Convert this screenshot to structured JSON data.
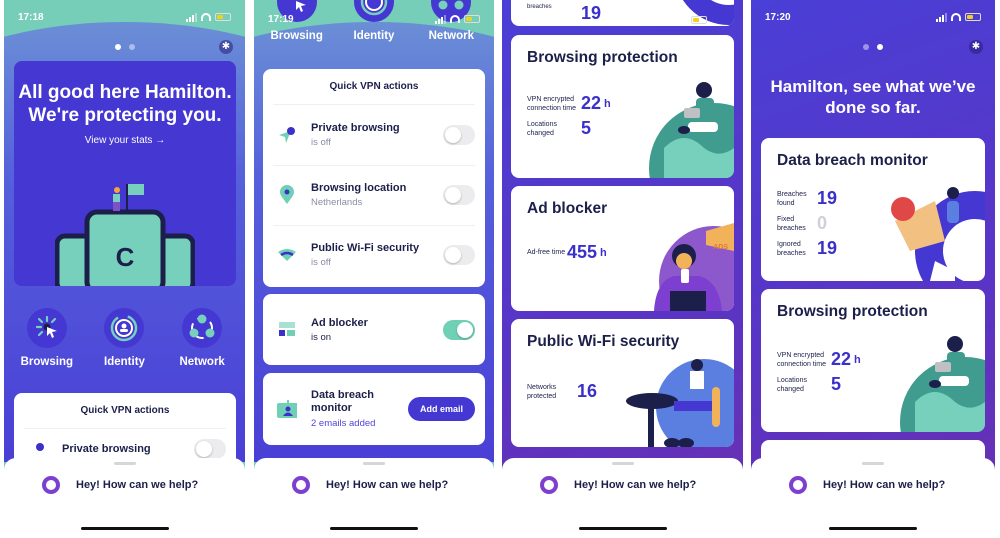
{
  "screens": [
    {
      "status": {
        "time": "17:18"
      },
      "hero": {
        "title": "All good here Hamilton. We're protecting you.",
        "link": "View your stats →"
      },
      "features": [
        {
          "label": "Browsing",
          "icon": "cursor-click-icon"
        },
        {
          "label": "Identity",
          "icon": "identity-shield-icon"
        },
        {
          "label": "Network",
          "icon": "network-icon"
        }
      ],
      "quick_vpn": {
        "title": "Quick VPN actions",
        "first_item": "Private browsing"
      },
      "help": "Hey! How can we help?"
    },
    {
      "status": {
        "time": "17:19"
      },
      "features": [
        {
          "label": "Browsing"
        },
        {
          "label": "Identity"
        },
        {
          "label": "Network"
        }
      ],
      "quick_vpn": {
        "title": "Quick VPN actions",
        "items": [
          {
            "title": "Private browsing",
            "sub": "is off",
            "on": false
          },
          {
            "title": "Browsing location",
            "sub": "Netherlands",
            "on": false
          },
          {
            "title": "Public Wi-Fi security",
            "sub": "is off",
            "on": false
          }
        ]
      },
      "ad_blocker": {
        "title": "Ad blocker",
        "sub": "is on",
        "on": true
      },
      "breach": {
        "title": "Data breach monitor",
        "sub": "2 emails added",
        "button": "Add email"
      },
      "help": "Hey! How can we help?"
    },
    {
      "top_partial": {
        "value": "19",
        "label": "breaches"
      },
      "browsing": {
        "title": "Browsing protection",
        "stats": [
          {
            "label": "VPN encrypted connection time",
            "value": "22",
            "unit": "h"
          },
          {
            "label": "Locations changed",
            "value": "5"
          }
        ]
      },
      "adblock": {
        "title": "Ad blocker",
        "stats": [
          {
            "label": "Ad-free time",
            "value": "455",
            "unit": "h"
          }
        ],
        "ads_label": "ADS"
      },
      "wifi": {
        "title": "Public Wi-Fi security",
        "stats": [
          {
            "label": "Networks protected",
            "value": "16"
          }
        ]
      },
      "help": "Hey! How can we help?"
    },
    {
      "status": {
        "time": "17:20"
      },
      "title": "Hamilton, see what we’ve done so far.",
      "breach": {
        "title": "Data breach monitor",
        "stats": [
          {
            "label": "Breaches found",
            "value": "19"
          },
          {
            "label": "Fixed breaches",
            "value": "0"
          },
          {
            "label": "Ignored breaches",
            "value": "19"
          }
        ]
      },
      "browsing": {
        "title": "Browsing protection",
        "stats": [
          {
            "label": "VPN encrypted connection time",
            "value": "22",
            "unit": "h"
          },
          {
            "label": "Locations changed",
            "value": "5"
          }
        ]
      },
      "help": "Hey! How can we help?"
    }
  ],
  "colors": {
    "primary": "#4437d2",
    "teal": "#76cdb8",
    "accent_purple": "#7d3fd0",
    "text": "#1b1f4a"
  }
}
